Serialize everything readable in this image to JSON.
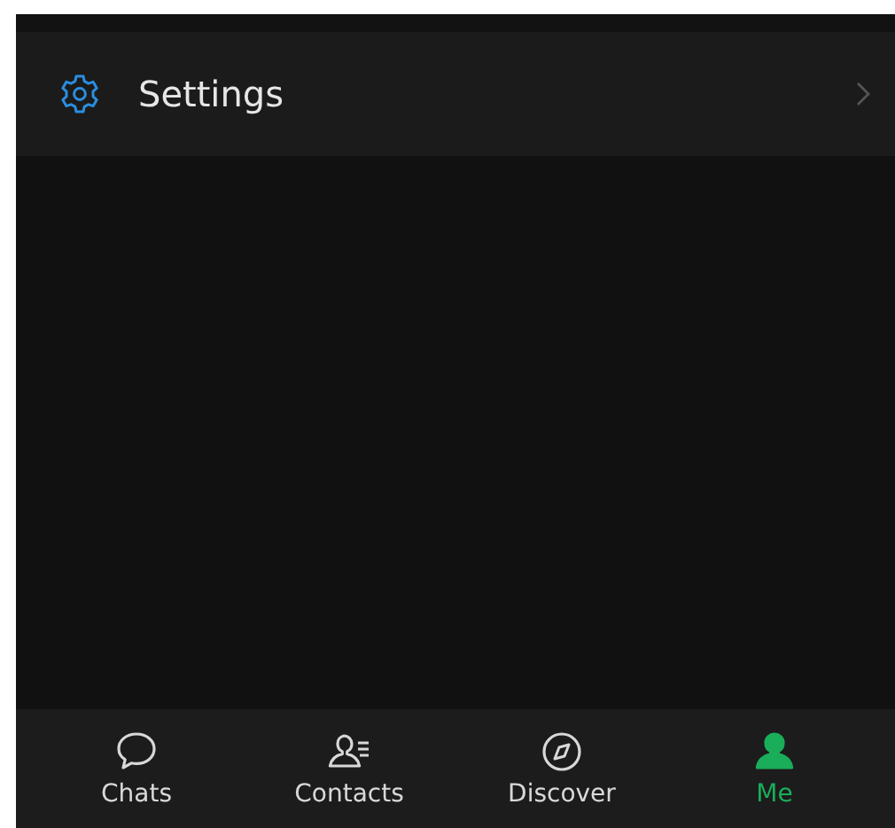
{
  "settings_row": {
    "label": "Settings"
  },
  "tabs": [
    {
      "label": "Chats",
      "selected": false
    },
    {
      "label": "Contacts",
      "selected": false
    },
    {
      "label": "Discover",
      "selected": false
    },
    {
      "label": "Me",
      "selected": true
    }
  ]
}
